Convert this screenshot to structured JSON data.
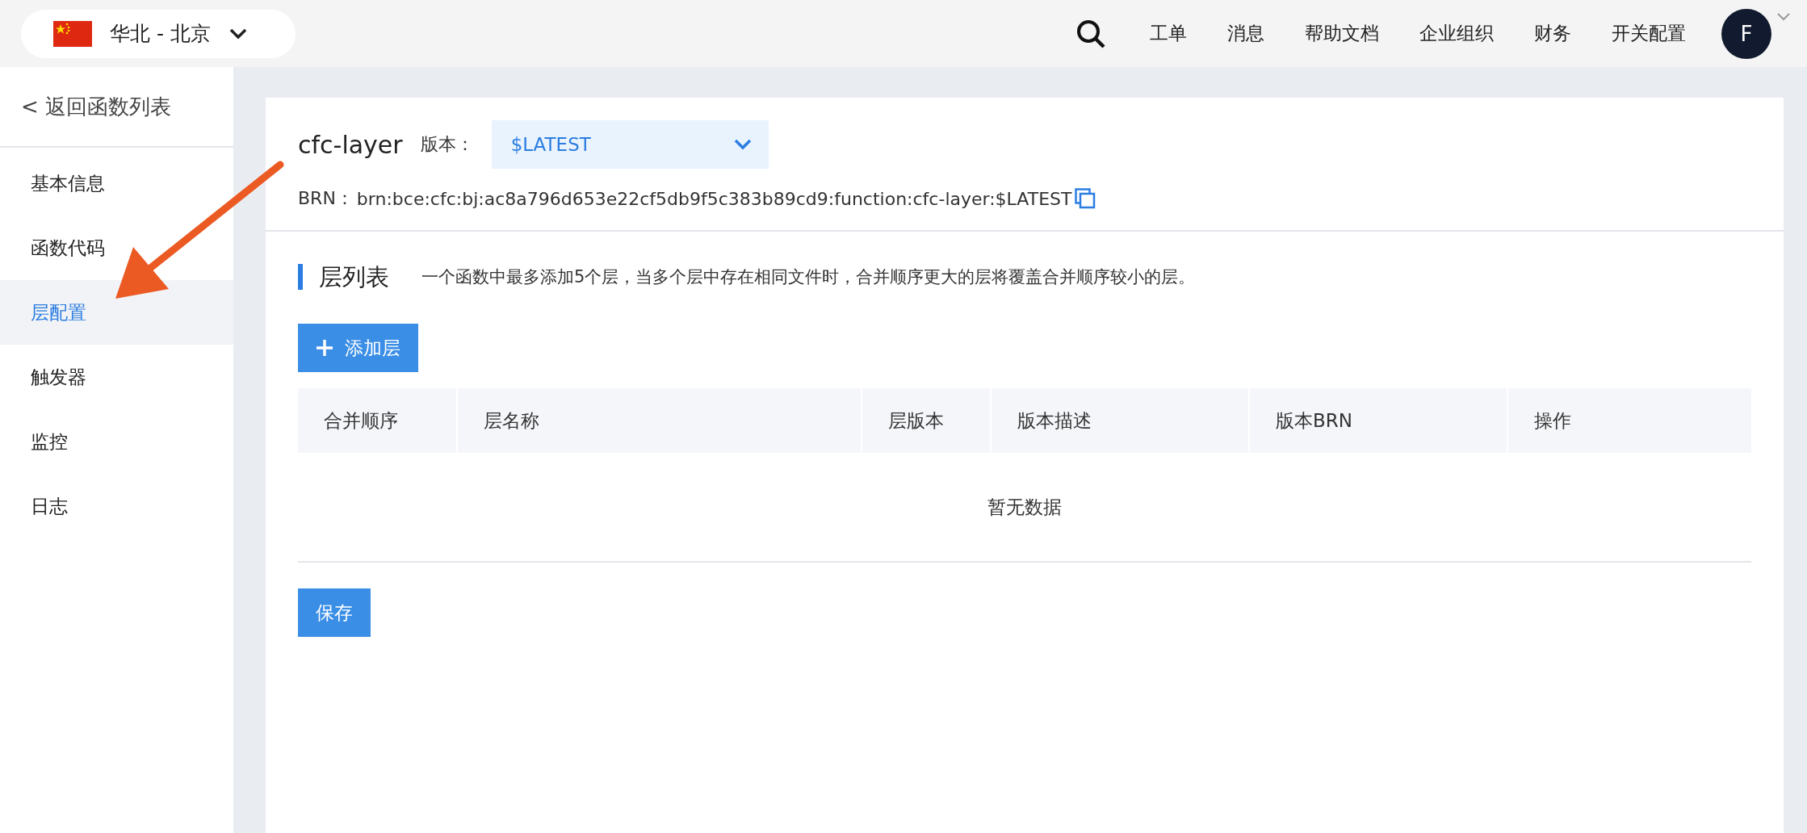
{
  "region": {
    "label": "华北 - 北京"
  },
  "nav": {
    "items": [
      "工单",
      "消息",
      "帮助文档",
      "企业组织",
      "财务",
      "开关配置"
    ],
    "avatar": "F"
  },
  "sidebar": {
    "back": "< 返回函数列表",
    "items": [
      {
        "label": "基本信息",
        "selected": false
      },
      {
        "label": "函数代码",
        "selected": false
      },
      {
        "label": "层配置",
        "selected": true
      },
      {
        "label": "触发器",
        "selected": false
      },
      {
        "label": "监控",
        "selected": false
      },
      {
        "label": "日志",
        "selected": false
      }
    ]
  },
  "function": {
    "name": "cfc-layer",
    "version_label": "版本：",
    "version": "$LATEST",
    "brn_label": "BRN：",
    "brn": "brn:bce:cfc:bj:ac8a796d653e22cf5db9f5c383b89cd9:function:cfc-layer:$LATEST"
  },
  "section": {
    "title": "层列表",
    "hint": "一个函数中最多添加5个层，当多个层中存在相同文件时，合并顺序更大的层将覆盖合并顺序较小的层。"
  },
  "add_button": "添加层",
  "table": {
    "columns": [
      "合并顺序",
      "层名称",
      "层版本",
      "版本描述",
      "版本BRN",
      "操作"
    ],
    "empty_text": "暂无数据"
  },
  "save_button": "保存"
}
